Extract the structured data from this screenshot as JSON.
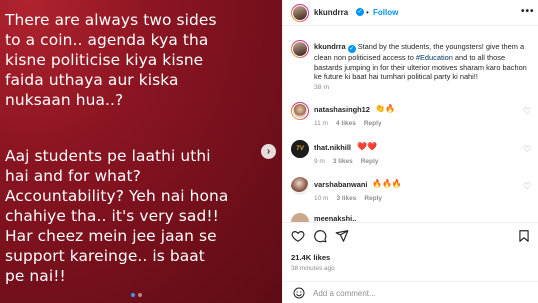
{
  "post": {
    "text_paragraph_1": "There are always two sides\nto a coin.. agenda kya tha\nkisne politicise kiya kisne\nfaida uthaya aur kiska\nnuksaan hua..?",
    "text_paragraph_2": "Aaj students pe laathi uthi\nhai and for what?\nAccountability? Yeh nai hona\nchahiye tha.. it's very sad!!\nHar cheez mein jee jaan se\nsupport kareinge.. is baat\npe nai!!",
    "next_glyph": "›",
    "carousel": {
      "count": 2,
      "active": 0
    }
  },
  "header": {
    "username": "kkundrra",
    "separator": "•",
    "follow_label": "Follow",
    "more_glyph": "•••"
  },
  "caption": {
    "username": "kkundrra",
    "text_before": " Stand by the students, the youngsters! give them a clean non politicised access to ",
    "hashtag": "#Education",
    "text_after": " and to all those bastards jumping in for their ulterior motives sharam karo bachon ke future ki baat hai tumhari political party ki nahi!!",
    "time": "38 m"
  },
  "comments": [
    {
      "username": "natashasingh12",
      "text": "👏🔥",
      "time": "11 m",
      "likes": "4 likes",
      "reply": "Reply"
    },
    {
      "username": "that.nikhill",
      "text": "❤️❤️",
      "time": "9 m",
      "likes": "3 likes",
      "reply": "Reply"
    },
    {
      "username": "varshabanwani",
      "text": "🔥🔥🔥",
      "time": "10 m",
      "likes": "3 likes",
      "reply": "Reply"
    },
    {
      "username": "meenakshi..",
      "text": "",
      "time": "",
      "likes": "",
      "reply": ""
    }
  ],
  "actions": {
    "likes": "21.4K likes",
    "time": "38 minutes ago",
    "comment_placeholder": "Add a comment..."
  },
  "colors": {
    "accent": "#0095f6",
    "image_background": "#8c1522",
    "muted": "#8e8e8e",
    "text": "#262626"
  }
}
